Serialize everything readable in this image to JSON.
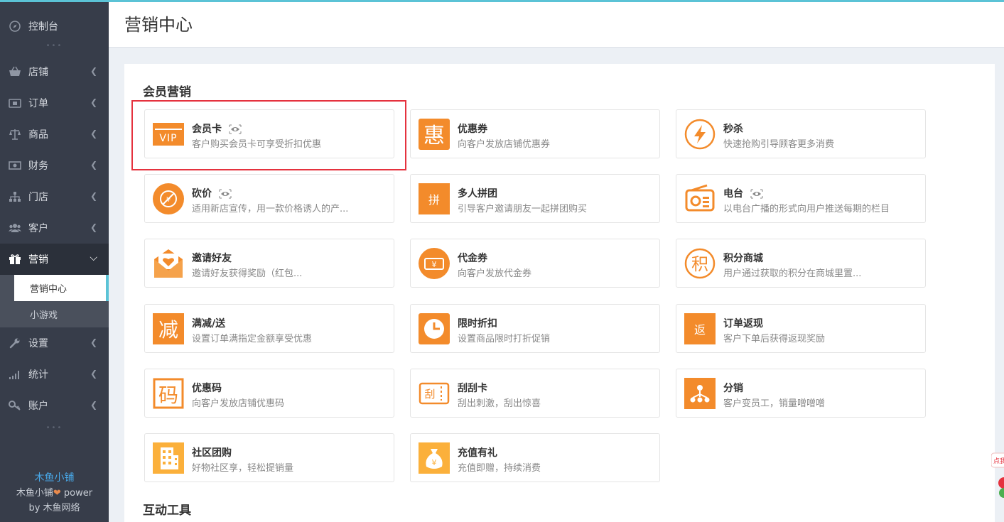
{
  "sidebar": {
    "items": [
      {
        "label": "控制台",
        "icon": "compass-icon"
      },
      {
        "label": "店铺",
        "icon": "basket-icon"
      },
      {
        "label": "订单",
        "icon": "wallet-icon"
      },
      {
        "label": "商品",
        "icon": "scale-icon"
      },
      {
        "label": "财务",
        "icon": "money-icon"
      },
      {
        "label": "门店",
        "icon": "sitemap-icon"
      },
      {
        "label": "客户",
        "icon": "users-icon"
      },
      {
        "label": "营销",
        "icon": "gift-icon"
      },
      {
        "label": "设置",
        "icon": "wrench-icon"
      },
      {
        "label": "统计",
        "icon": "signal-icon"
      },
      {
        "label": "账户",
        "icon": "key-icon"
      }
    ],
    "sub_items": [
      {
        "label": "营销中心"
      },
      {
        "label": "小游戏"
      }
    ],
    "dots": "•••",
    "brand": {
      "name": "木鱼小铺",
      "power_prefix": "木鱼小铺",
      "power_suffix": " power",
      "by": "by 木鱼网络"
    }
  },
  "header": {
    "title": "营销中心"
  },
  "sections": [
    {
      "title": "会员营销"
    },
    {
      "title": "互动工具"
    }
  ],
  "cards": [
    {
      "title": "会员卡",
      "desc": "客户购买会员卡可享受折扣优惠",
      "icon": "vip-card-icon",
      "eye": true
    },
    {
      "title": "优惠券",
      "desc": "向客户发放店铺优惠券",
      "icon": "hui-icon",
      "eye": false
    },
    {
      "title": "秒杀",
      "desc": "快速抢购引导顾客更多消费",
      "icon": "lightning-icon",
      "eye": false
    },
    {
      "title": "砍价",
      "desc": "适用新店宣传，用一款价格诱人的产...",
      "icon": "bargain-icon",
      "eye": true
    },
    {
      "title": "多人拼团",
      "desc": "引导客户邀请朋友一起拼团购买",
      "icon": "group-buy-icon",
      "eye": false
    },
    {
      "title": "电台",
      "desc": "以电台广播的形式向用户推送每期的栏目",
      "icon": "radio-icon",
      "eye": true
    },
    {
      "title": "邀请好友",
      "desc": "邀请好友获得奖励（红包...",
      "icon": "invite-envelope-icon",
      "eye": false
    },
    {
      "title": "代金券",
      "desc": "向客户发放代金券",
      "icon": "voucher-icon",
      "eye": false
    },
    {
      "title": "积分商城",
      "desc": "用户通过获取的积分在商城里置...",
      "icon": "points-icon",
      "eye": false
    },
    {
      "title": "满减/送",
      "desc": "设置订单满指定金额享受优惠",
      "icon": "discount-jian-icon",
      "eye": false
    },
    {
      "title": "限时折扣",
      "desc": "设置商品限时打折促销",
      "icon": "clock-icon",
      "eye": false
    },
    {
      "title": "订单返现",
      "desc": "客户下单后获得返现奖励",
      "icon": "cashback-icon",
      "eye": false
    },
    {
      "title": "优惠码",
      "desc": "向客户发放店铺优惠码",
      "icon": "code-ma-icon",
      "eye": false
    },
    {
      "title": "刮刮卡",
      "desc": "刮出刺激，刮出惊喜",
      "icon": "scratch-card-icon",
      "eye": false
    },
    {
      "title": "分销",
      "desc": "客户变员工，销量噌噌噌",
      "icon": "distribution-icon",
      "eye": false
    },
    {
      "title": "社区团购",
      "desc": "好物社区享，轻松提销量",
      "icon": "building-icon",
      "eye": false
    },
    {
      "title": "充值有礼",
      "desc": "充值即赠，持续消费",
      "icon": "money-bag-icon",
      "eye": false
    }
  ],
  "icon_glyphs": {
    "vip": "VIP",
    "hui": "惠",
    "pin": "拼",
    "ji": "积",
    "jian": "减",
    "fan": "返",
    "ma": "码",
    "gua": "刮",
    "yuan": "¥"
  },
  "float_widget": {
    "label": "点我"
  },
  "colors": {
    "accent": "#f38b2b",
    "sidebar_bg": "#373d4a",
    "highlight_border": "#e5323e",
    "top_line": "#5bc3d6"
  }
}
